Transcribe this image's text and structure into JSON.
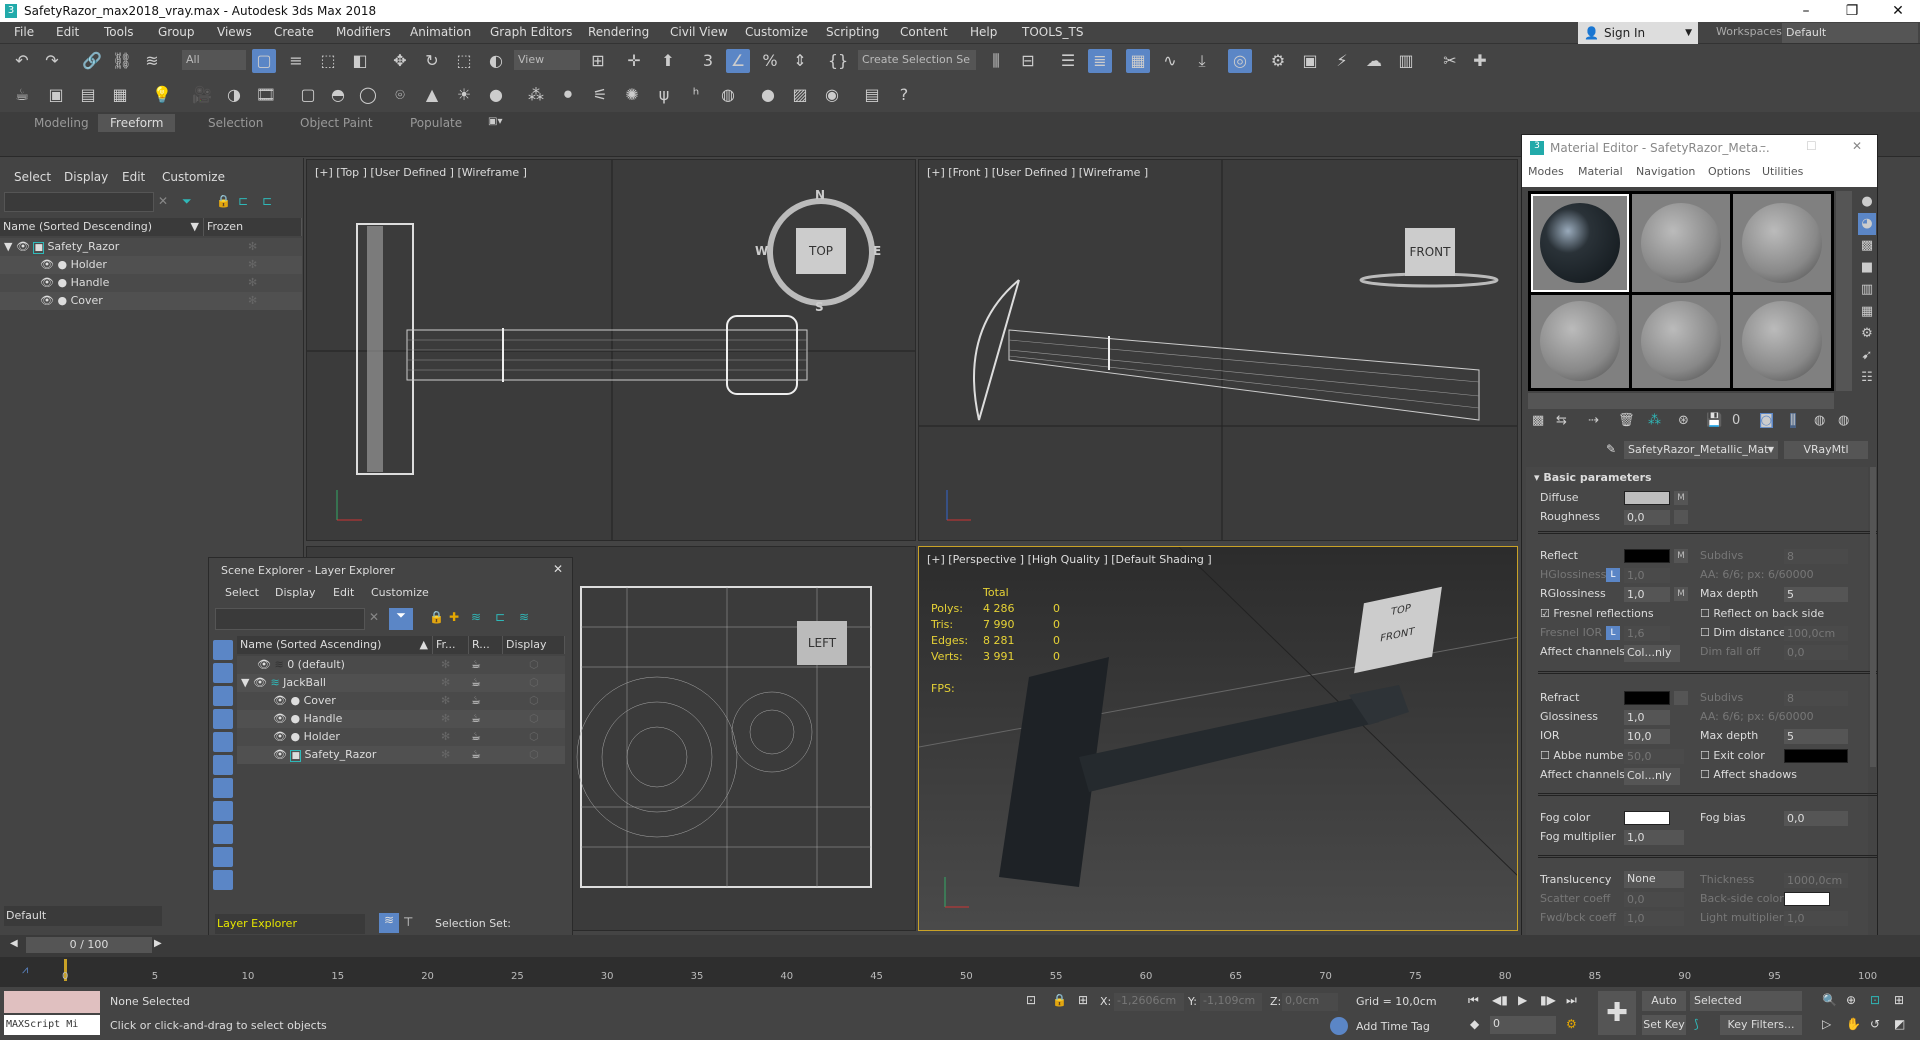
{
  "window": {
    "title": "SafetyRazor_max2018_vray.max - Autodesk 3ds Max 2018",
    "minimize": "–",
    "restore": "❐",
    "close": "✕"
  },
  "menu": [
    "File",
    "Edit",
    "Tools",
    "Group",
    "Views",
    "Create",
    "Modifiers",
    "Animation",
    "Graph Editors",
    "Rendering",
    "Civil View",
    "Customize",
    "Scripting",
    "Content",
    "Help",
    "TOOLS_TS"
  ],
  "toolbar": {
    "filter": "All",
    "view": "View",
    "selection_set": "Create Selection Se",
    "sign_in": "Sign In",
    "workspaces_label": "Workspaces:",
    "workspace": "Default"
  },
  "ribbon": {
    "tabs": [
      "Modeling",
      "Freeform",
      "Selection",
      "Object Paint",
      "Populate"
    ],
    "active": "Freeform"
  },
  "left_explorer": {
    "menu": [
      "Select",
      "Display",
      "Edit",
      "Customize"
    ],
    "col_name": "Name (Sorted Descending)",
    "col_frozen": "Frozen",
    "rows": [
      "Safety_Razor",
      "Holder",
      "Handle",
      "Cover"
    ],
    "layer": "Default",
    "frame": "0 / 100"
  },
  "viewports": {
    "top": "[+] [Top ] [User Defined ] [Wireframe ]",
    "front": "[+] [Front ] [User Defined ] [Wireframe ]",
    "left_cube": "LEFT",
    "persp": "[+] [Perspective ] [High Quality ] [Default Shading ]",
    "top_cube": "TOP",
    "front_cube": "FRONT",
    "compass": {
      "n": "N",
      "s": "S",
      "e": "E",
      "w": "W"
    },
    "persp_cube_top": "TOP",
    "persp_cube_front": "FRONT"
  },
  "stats": {
    "total": "Total",
    "rows": [
      {
        "label": "Polys:",
        "total": "4 286",
        "sel": "0"
      },
      {
        "label": "Tris:",
        "total": "7 990",
        "sel": "0"
      },
      {
        "label": "Edges:",
        "total": "8 281",
        "sel": "0"
      },
      {
        "label": "Verts:",
        "total": "3 991",
        "sel": "0"
      }
    ],
    "fps": "FPS:"
  },
  "layer_explorer": {
    "title": "Scene Explorer - Layer Explorer",
    "menu": [
      "Select",
      "Display",
      "Edit",
      "Customize"
    ],
    "cols": [
      "Name (Sorted Ascending)",
      "Fr...",
      "R...",
      "Display a..."
    ],
    "rows": [
      "0 (default)",
      "JackBall",
      "Cover",
      "Handle",
      "Holder",
      "Safety_Razor"
    ],
    "explorer": "Layer Explorer",
    "selection_set": "Selection Set:"
  },
  "material_editor": {
    "title": "Material Editor - SafetyRazor_Meta...",
    "menu": [
      "Modes",
      "Material",
      "Navigation",
      "Options",
      "Utilities"
    ],
    "material": "SafetyRazor_Metallic_Mat",
    "type": "VRayMtl",
    "rollout": "Basic parameters",
    "diffuse": "Diffuse",
    "roughness": "Roughness",
    "roughness_v": "0,0",
    "reflect": "Reflect",
    "hgloss": "HGlossiness",
    "hgloss_v": "1,0",
    "rgloss": "RGlossiness",
    "rgloss_v": "1,0",
    "fresnel": "Fresnel reflections",
    "fresnel_ior": "Fresnel IOR",
    "fresnel_ior_v": "1,6",
    "affect": "Affect channels",
    "affect_v": "Col...nly",
    "subdivs": "Subdivs",
    "subdivs_v": "8",
    "aa": "AA: 6/6; px: 6/60000",
    "maxdepth": "Max depth",
    "maxdepth_v": "5",
    "backside": "Reflect on back side",
    "dimdist": "Dim distance",
    "dimdist_v": "100,0cm",
    "dimfall": "Dim fall off",
    "dimfall_v": "0,0",
    "refract": "Refract",
    "gloss": "Glossiness",
    "gloss_v": "1,0",
    "ior": "IOR",
    "ior_v": "10,0",
    "abbe": "Abbe number",
    "abbe_v": "50,0",
    "exit": "Exit color",
    "affect_shadows": "Affect shadows",
    "fogcolor": "Fog color",
    "fogmult": "Fog multiplier",
    "fogmult_v": "1,0",
    "fogbias": "Fog bias",
    "fogbias_v": "0,0",
    "transl": "Translucency",
    "transl_v": "None",
    "thickness": "Thickness",
    "thickness_v": "1000,0cm",
    "scatter": "Scatter coeff",
    "scatter_v": "0,0",
    "backcolor": "Back-side color",
    "fwd": "Fwd/bck coeff",
    "fwd_v": "1,0",
    "lightmult": "Light multiplier",
    "lightmult_v": "1,0",
    "m": "M",
    "l": "L"
  },
  "timeline": {
    "ticks": [
      "0",
      "5",
      "10",
      "15",
      "20",
      "25",
      "30",
      "35",
      "40",
      "45",
      "50",
      "55",
      "60",
      "65",
      "70",
      "75",
      "80",
      "85",
      "90",
      "95",
      "100"
    ]
  },
  "status": {
    "maxscript": "MAXScript Mi",
    "selected": "None Selected",
    "prompt": "Click or click-and-drag to select objects",
    "x_label": "X:",
    "x": "-1,2606cm",
    "y_label": "Y:",
    "y": "-1,109cm",
    "z_label": "Z:",
    "z": "0,0cm",
    "grid": "Grid = 10,0cm",
    "add_time_tag": "Add Time Tag",
    "auto_key": "Auto Key",
    "selected_dd": "Selected",
    "set_key": "Set Key",
    "key_filters": "Key Filters...",
    "frame": "0"
  },
  "colors": {
    "accent": "#5b86c6",
    "stats": "#e6d236",
    "teal": "#2fb8b8"
  }
}
